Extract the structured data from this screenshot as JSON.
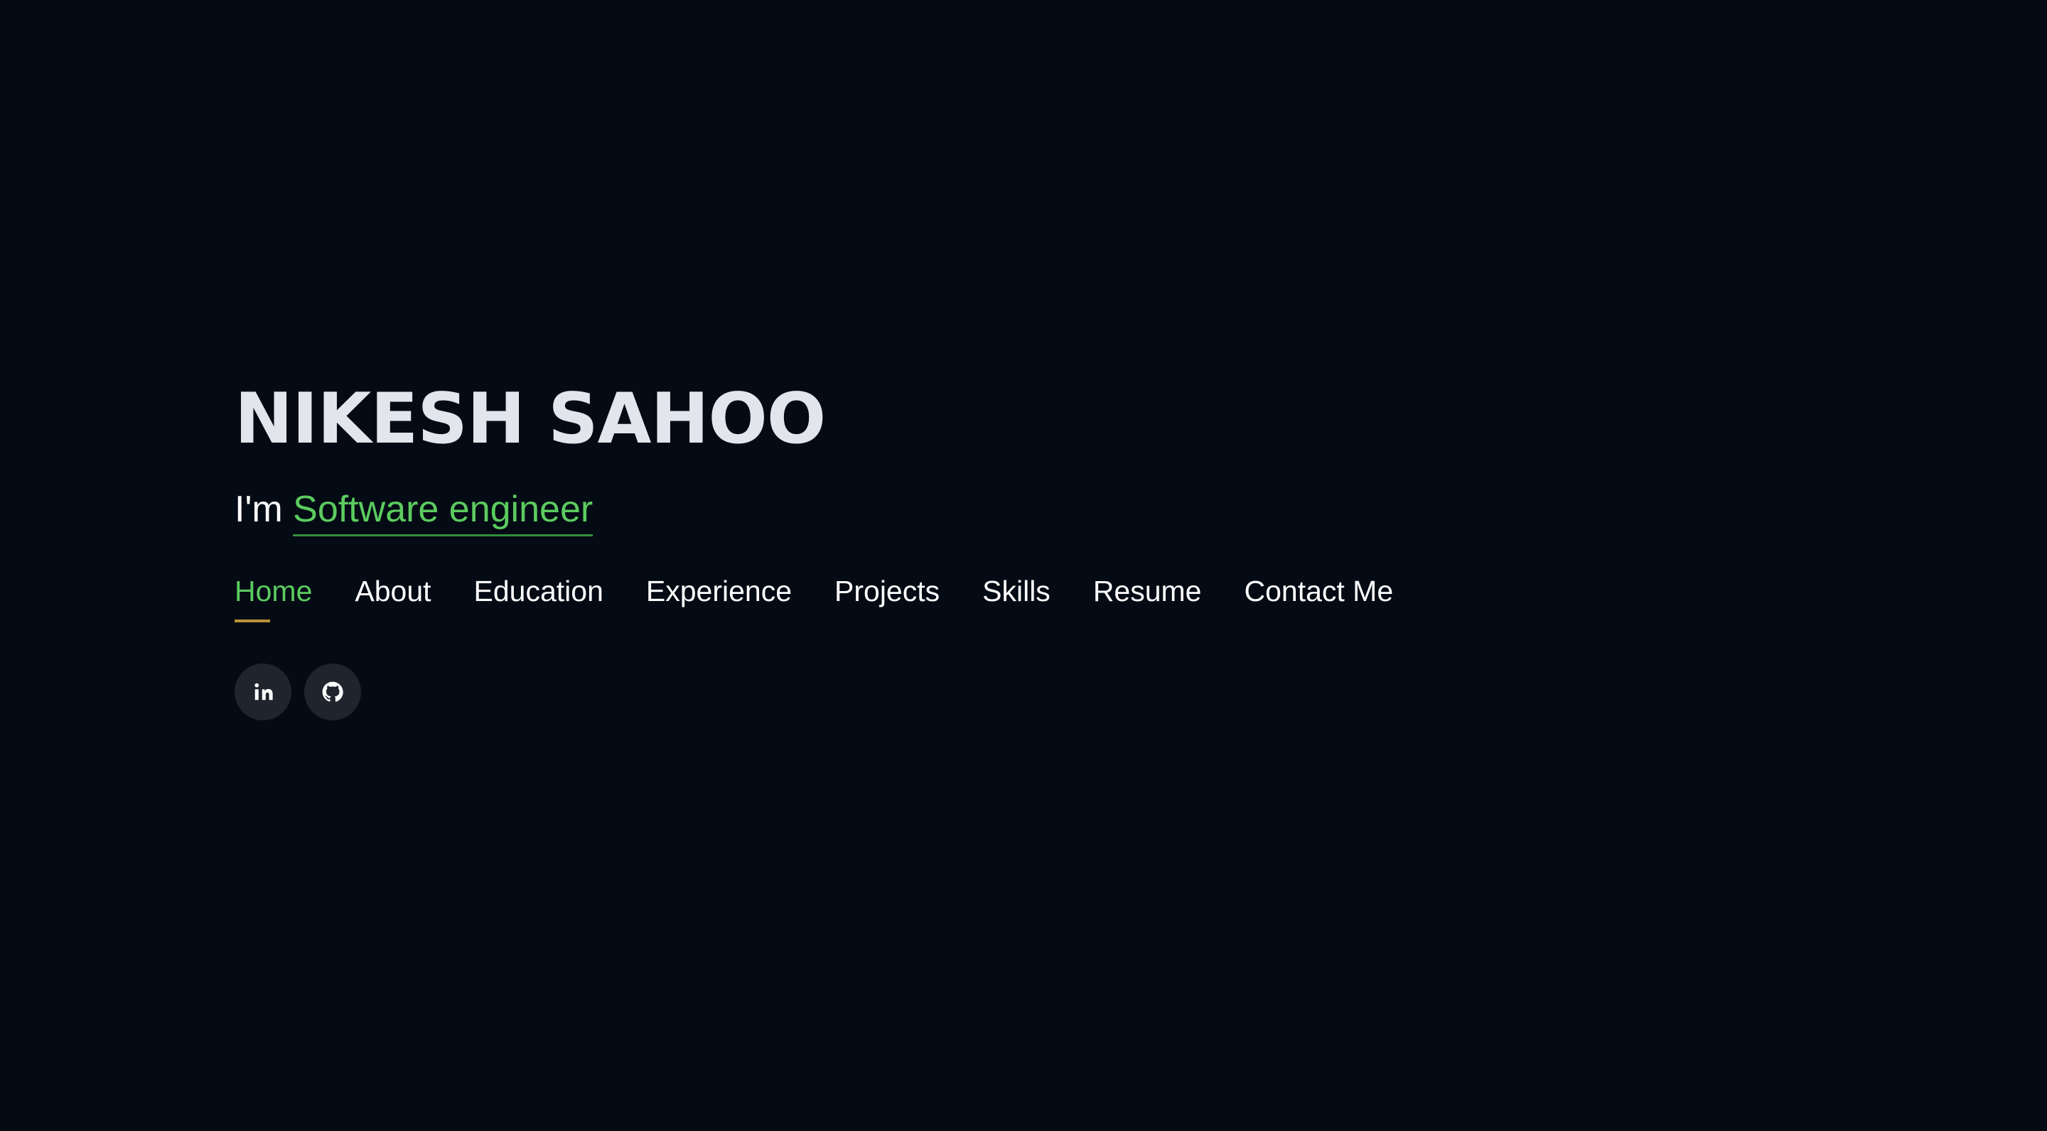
{
  "hero": {
    "name": "NIKESH SAHOO",
    "prefix": "I'm ",
    "role": "Software engineer"
  },
  "nav": {
    "items": [
      {
        "label": "Home",
        "active": true
      },
      {
        "label": "About"
      },
      {
        "label": "Education"
      },
      {
        "label": "Experience"
      },
      {
        "label": "Projects"
      },
      {
        "label": "Skills"
      },
      {
        "label": "Resume"
      },
      {
        "label": "Contact Me"
      }
    ]
  },
  "social": {
    "linkedin_icon": "linkedin-icon",
    "github_icon": "github-icon"
  },
  "colors": {
    "background": "#040b14",
    "accent": "#5ccb5f",
    "underline": "#b99238"
  }
}
